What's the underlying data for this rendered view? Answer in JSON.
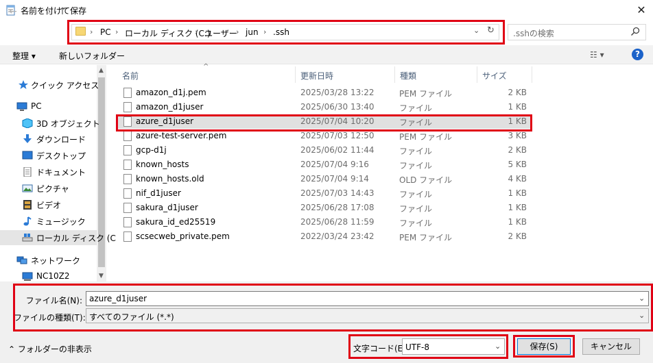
{
  "window": {
    "title": "名前を付けて保存",
    "close": "✕"
  },
  "nav": {
    "back": "←",
    "forward": "→",
    "recent": "⌄",
    "up": "↑"
  },
  "address": {
    "crumbs": [
      "PC",
      "ローカル ディスク (C:)",
      "ユーザー",
      "jun",
      ".ssh"
    ],
    "separator": "›",
    "dropdown": "⌄",
    "refresh": "↻"
  },
  "search": {
    "placeholder": ".sshの検索"
  },
  "toolbar": {
    "organize": "整理 ▾",
    "new_folder": "新しいフォルダー",
    "view": "☷ ▾",
    "help": "?"
  },
  "sidebar": {
    "items": [
      {
        "label": "クイック アクセス",
        "icon": "star-icon"
      },
      {
        "label": "PC",
        "icon": "computer-icon"
      },
      {
        "label": "3D オブジェクト",
        "icon": "cube-icon"
      },
      {
        "label": "ダウンロード",
        "icon": "download-icon"
      },
      {
        "label": "デスクトップ",
        "icon": "desktop-icon"
      },
      {
        "label": "ドキュメント",
        "icon": "document-icon"
      },
      {
        "label": "ピクチャ",
        "icon": "picture-icon"
      },
      {
        "label": "ビデオ",
        "icon": "video-icon"
      },
      {
        "label": "ミュージック",
        "icon": "music-icon"
      },
      {
        "label": "ローカル ディスク (C",
        "icon": "drive-icon"
      },
      {
        "label": "ネットワーク",
        "icon": "network-icon"
      },
      {
        "label": "NC10Z2",
        "icon": "computer-icon"
      }
    ]
  },
  "columns": {
    "name": "名前",
    "date": "更新日時",
    "type": "種類",
    "size": "サイズ",
    "sort_indicator": "^"
  },
  "files": [
    {
      "name": "amazon_d1j.pem",
      "date": "2025/03/28 13:22",
      "type": "PEM ファイル",
      "size": "2 KB"
    },
    {
      "name": "amazon_d1juser",
      "date": "2025/06/30 13:40",
      "type": "ファイル",
      "size": "1 KB"
    },
    {
      "name": "azure_d1juser",
      "date": "2025/07/04 10:20",
      "type": "ファイル",
      "size": "1 KB"
    },
    {
      "name": "azure-test-server.pem",
      "date": "2025/07/03 12:50",
      "type": "PEM ファイル",
      "size": "3 KB"
    },
    {
      "name": "gcp-d1j",
      "date": "2025/06/02 11:44",
      "type": "ファイル",
      "size": "2 KB"
    },
    {
      "name": "known_hosts",
      "date": "2025/07/04 9:16",
      "type": "ファイル",
      "size": "5 KB"
    },
    {
      "name": "known_hosts.old",
      "date": "2025/07/04 9:14",
      "type": "OLD ファイル",
      "size": "4 KB"
    },
    {
      "name": "nif_d1juser",
      "date": "2025/07/03 14:43",
      "type": "ファイル",
      "size": "1 KB"
    },
    {
      "name": "sakura_d1juser",
      "date": "2025/06/28 17:08",
      "type": "ファイル",
      "size": "1 KB"
    },
    {
      "name": "sakura_id_ed25519",
      "date": "2025/06/28 11:59",
      "type": "ファイル",
      "size": "1 KB"
    },
    {
      "name": "scsecweb_private.pem",
      "date": "2022/03/24 23:42",
      "type": "PEM ファイル",
      "size": "2 KB"
    }
  ],
  "form": {
    "filename_label": "ファイル名(N):",
    "filename_value": "azure_d1juser",
    "filetype_label": "ファイルの種類(T):",
    "filetype_value": "すべてのファイル  (*.*)",
    "arrow": "⌄"
  },
  "footer": {
    "hide_folders": "⌃  フォルダーの非表示",
    "encoding_label": "文字コード(E):",
    "encoding_value": "UTF-8",
    "save": "保存(S)",
    "cancel": "キャンセル"
  },
  "colors": {
    "highlight": "#e00014",
    "selection": "#e0e0e0",
    "accent": "#1b62c9"
  }
}
